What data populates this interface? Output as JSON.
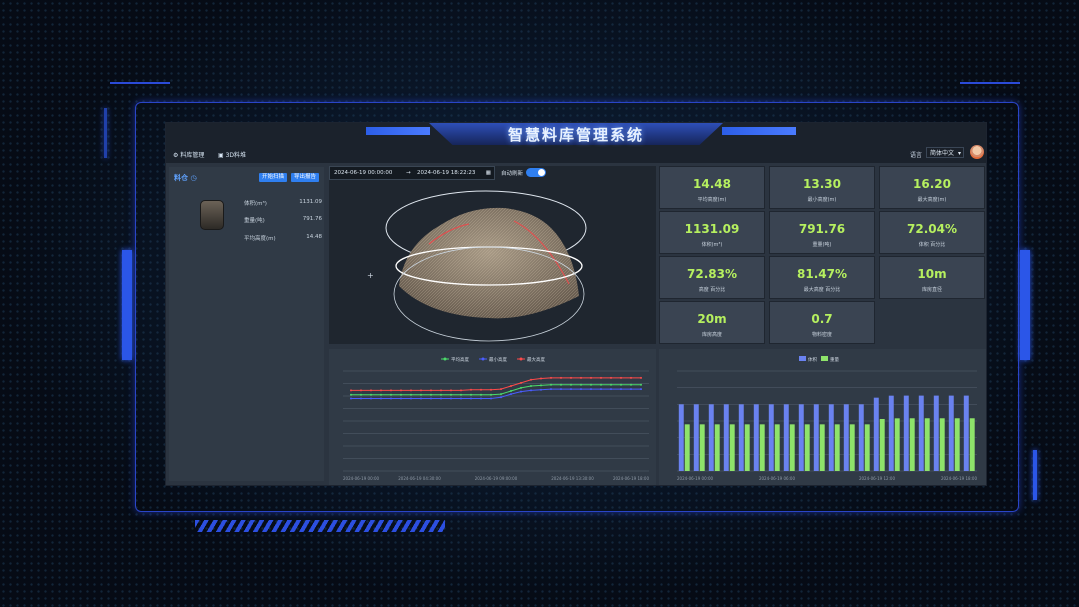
{
  "app": {
    "title": "智慧料库管理系统",
    "nav": [
      {
        "label": "料库管理"
      },
      {
        "label": "3D料堆"
      }
    ],
    "language_label": "语言",
    "language_value": "简体中文"
  },
  "left_panel": {
    "title": "料仓",
    "buttons": [
      "开始扫描",
      "导出报告"
    ],
    "rows": [
      {
        "label": "体积(m³)",
        "value": "1131.09"
      },
      {
        "label": "重量(吨)",
        "value": "791.76"
      },
      {
        "label": "平均高度(m)",
        "value": "14.48"
      }
    ]
  },
  "toolbar": {
    "date_start": "2024-06-19 00:00:00",
    "date_end": "2024-06-19 18:22:23",
    "auto_refresh_label": "自动刷新",
    "auto_refresh_on": true
  },
  "stats": [
    {
      "value": "14.48",
      "label": "平均高度(m)"
    },
    {
      "value": "13.30",
      "label": "最小高度(m)"
    },
    {
      "value": "16.20",
      "label": "最大高度(m)"
    },
    {
      "value": "1131.09",
      "label": "体积(m³)"
    },
    {
      "value": "791.76",
      "label": "重量(吨)"
    },
    {
      "value": "72.04%",
      "label": "体积 百分比"
    },
    {
      "value": "72.83%",
      "label": "高度 百分比"
    },
    {
      "value": "81.47%",
      "label": "最大高度 百分比"
    },
    {
      "value": "10m",
      "label": "库房直径"
    },
    {
      "value": "20m",
      "label": "库房高度"
    },
    {
      "value": "0.7",
      "label": "物料密度"
    }
  ],
  "chart_data": [
    {
      "type": "line",
      "series": [
        {
          "name": "平均高度",
          "color": "#4bdc6a",
          "values": [
            12.2,
            12.2,
            12.2,
            12.2,
            12.2,
            12.2,
            12.2,
            12.2,
            12.2,
            12.2,
            12.2,
            12.2,
            12.2,
            12.2,
            12.2,
            12.3,
            12.8,
            13.3,
            13.6,
            13.7,
            13.8,
            13.8,
            13.8,
            13.8,
            13.8,
            13.8,
            13.8,
            13.8,
            13.8,
            13.8
          ]
        },
        {
          "name": "最小高度",
          "color": "#4a5dff",
          "values": [
            11.6,
            11.6,
            11.6,
            11.6,
            11.6,
            11.6,
            11.6,
            11.6,
            11.6,
            11.6,
            11.6,
            11.6,
            11.6,
            11.6,
            11.6,
            11.8,
            12.3,
            12.7,
            12.9,
            13.0,
            13.1,
            13.1,
            13.1,
            13.1,
            13.1,
            13.1,
            13.1,
            13.1,
            13.1,
            13.1
          ]
        },
        {
          "name": "最大高度",
          "color": "#ff4a4a",
          "values": [
            12.9,
            12.9,
            12.9,
            12.9,
            12.9,
            12.9,
            12.9,
            12.9,
            12.9,
            12.9,
            12.9,
            12.9,
            13.0,
            13.0,
            13.0,
            13.1,
            13.6,
            14.1,
            14.6,
            14.8,
            14.9,
            14.9,
            14.9,
            14.9,
            14.9,
            14.9,
            14.9,
            14.9,
            14.9,
            14.9
          ]
        }
      ],
      "ylim": [
        0,
        16
      ],
      "x_ticks": [
        "2024-06-19 00:00",
        "2024-06-19 04:30:00",
        "2024-06-19 09:00:00",
        "2024-06-19 13:30:00",
        "2024-06-19 18:00"
      ]
    },
    {
      "type": "bar",
      "series": [
        {
          "name": "体积",
          "color": "#6a82f0",
          "values": [
            1000,
            1000,
            1000,
            1000,
            1000,
            1000,
            1000,
            1000,
            1000,
            1000,
            1000,
            1000,
            1000,
            1100,
            1130,
            1131,
            1131,
            1131,
            1131,
            1131
          ]
        },
        {
          "name": "重量",
          "color": "#8ee36a",
          "values": [
            700,
            700,
            700,
            700,
            700,
            700,
            700,
            700,
            700,
            700,
            700,
            700,
            700,
            780,
            790,
            791,
            791,
            791,
            791,
            791
          ]
        }
      ],
      "ylim": [
        0,
        1500
      ],
      "x_ticks": [
        "2024-06-19 00:00",
        "2024-06-19 06:00",
        "2024-06-19 12:00",
        "2024-06-19 18:00"
      ]
    }
  ]
}
